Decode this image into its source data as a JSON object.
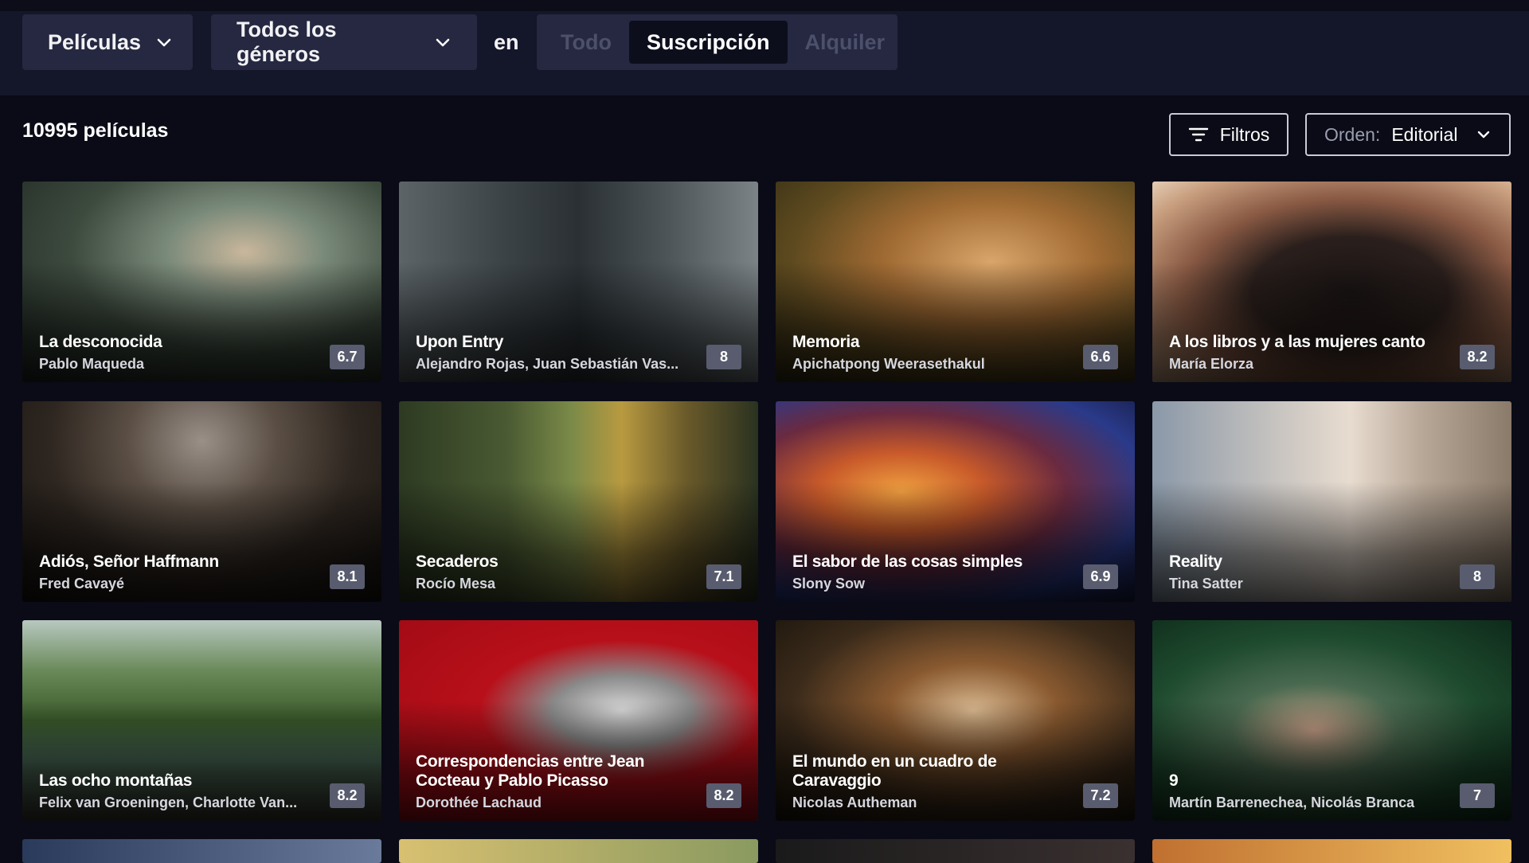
{
  "filters": {
    "type_dropdown": "Películas",
    "genre_dropdown": "Todos los géneros",
    "en_label": "en",
    "availability_options": [
      "Todo",
      "Suscripción",
      "Alquiler"
    ],
    "availability_selected": "Suscripción"
  },
  "results": {
    "count_label": "10995 películas",
    "filters_button": "Filtros",
    "sort_label": "Orden:",
    "sort_value": "Editorial"
  },
  "movies": [
    {
      "title": "La desconocida",
      "director": "Pablo Maqueda",
      "rating": "6.7"
    },
    {
      "title": "Upon Entry",
      "director": "Alejandro Rojas, Juan Sebastián Vas...",
      "rating": "8"
    },
    {
      "title": "Memoria",
      "director": "Apichatpong Weerasethakul",
      "rating": "6.6"
    },
    {
      "title": "A los libros y a las mujeres canto",
      "director": "María Elorza",
      "rating": "8.2"
    },
    {
      "title": "Adiós, Señor Haffmann",
      "director": "Fred Cavayé",
      "rating": "8.1"
    },
    {
      "title": "Secaderos",
      "director": "Rocío Mesa",
      "rating": "7.1"
    },
    {
      "title": "El sabor de las cosas simples",
      "director": "Slony Sow",
      "rating": "6.9"
    },
    {
      "title": "Reality",
      "director": "Tina Satter",
      "rating": "8"
    },
    {
      "title": "Las ocho montañas",
      "director": "Felix van Groeningen, Charlotte Van...",
      "rating": "8.2"
    },
    {
      "title": "Correspondencias entre Jean Cocteau y Pablo Picasso",
      "director": "Dorothée Lachaud",
      "rating": "8.2"
    },
    {
      "title": "El mundo en un cuadro de Caravaggio",
      "director": "Nicolas Autheman",
      "rating": "7.2"
    },
    {
      "title": "9",
      "director": "Martín Barrenechea, Nicolás Branca",
      "rating": "7"
    }
  ],
  "colors": {
    "background": "#0a0b16",
    "topbar": "#14162a",
    "control": "#252840",
    "rating_badge": "#585c6e"
  },
  "icons": {
    "dropdown": "chevron-down-icon",
    "filters": "filter-lines-icon"
  }
}
